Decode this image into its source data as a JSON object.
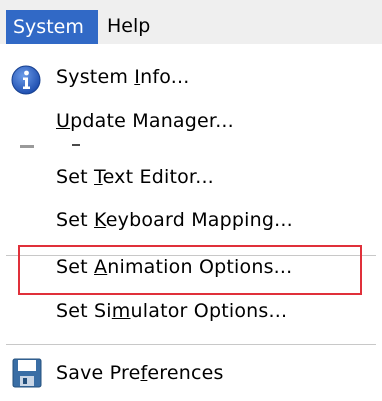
{
  "menubar": {
    "items": [
      {
        "label": "System",
        "active": true
      },
      {
        "label": "Help",
        "active": false
      }
    ]
  },
  "menu": {
    "items": [
      {
        "pre": "System ",
        "ul": "I",
        "post": "nfo...",
        "icon": "info-icon"
      },
      {
        "pre": "",
        "ul": "U",
        "post": "pdate Manager...",
        "icon": "update-icon"
      },
      {
        "pre": "Set ",
        "ul": "T",
        "post": "ext Editor...",
        "icon": null
      },
      {
        "pre": "Set ",
        "ul": "K",
        "post": "eyboard Mapping...",
        "icon": null
      },
      {
        "pre": "Set ",
        "ul": "A",
        "post": "nimation Options...",
        "icon": null,
        "highlighted": true
      },
      {
        "pre": "Set Si",
        "ul": "m",
        "post": "ulator Options...",
        "icon": null
      },
      {
        "pre": "Save Pre",
        "ul": "f",
        "post": "erences",
        "icon": "save-icon"
      }
    ]
  },
  "colors": {
    "menubar_active_bg": "#3169c6",
    "highlight_border": "#e0303a",
    "info_icon": "#2a5fc4",
    "save_icon": "#3a6ea5"
  }
}
